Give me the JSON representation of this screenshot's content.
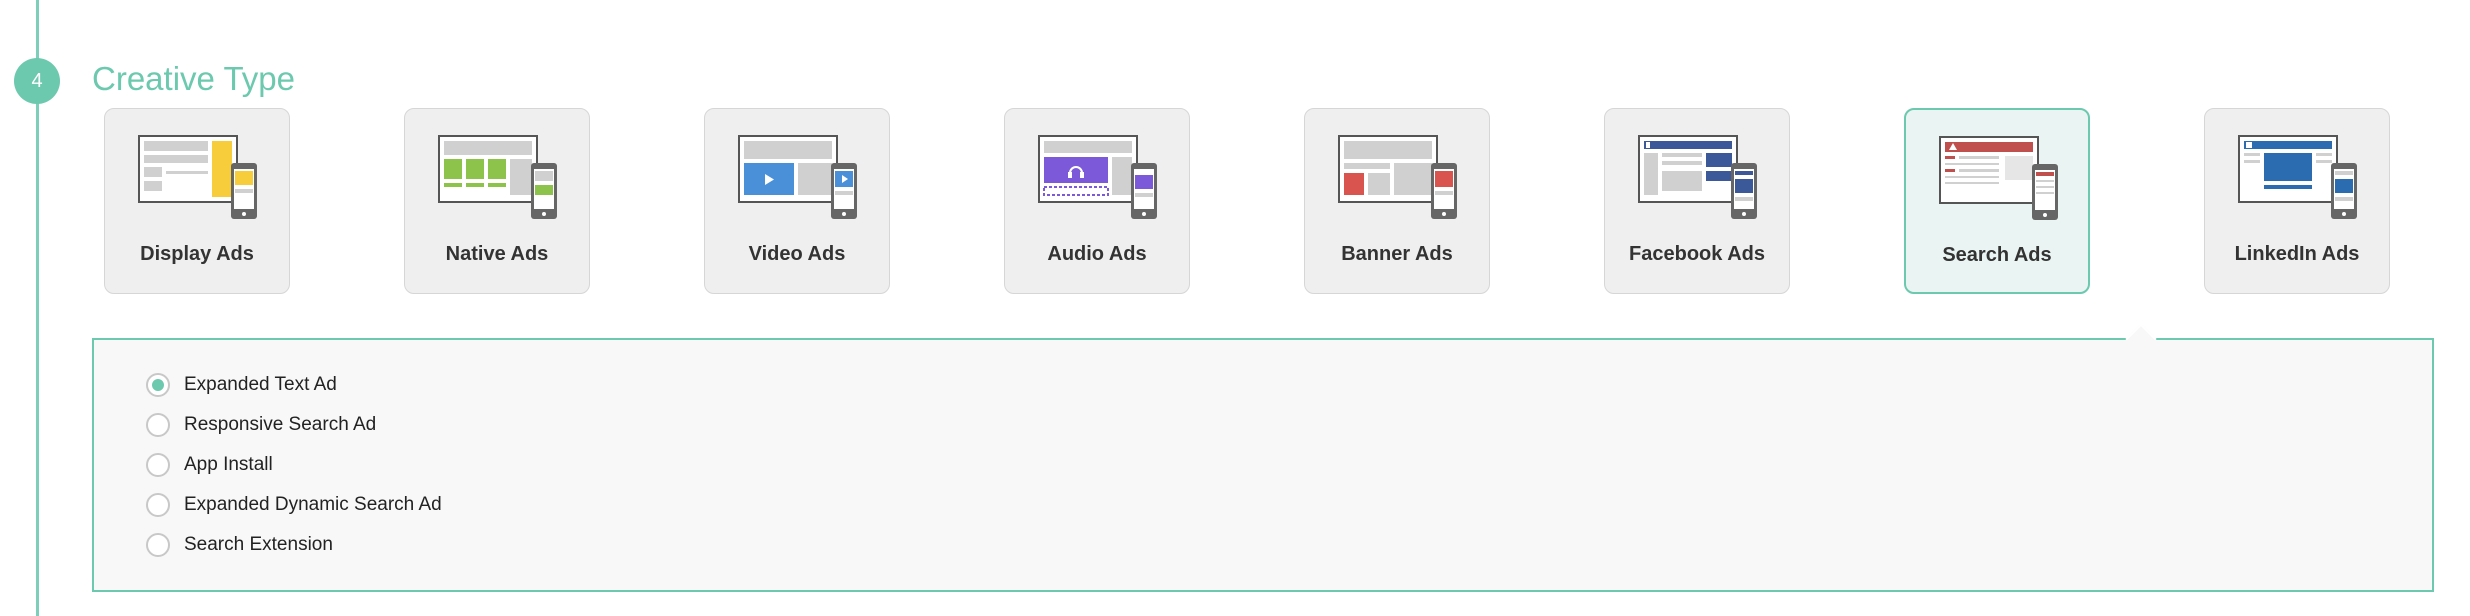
{
  "step": {
    "number": "4",
    "title": "Creative Type"
  },
  "creative_types": [
    {
      "id": "display",
      "label": "Display Ads",
      "icon": "display-ads-icon",
      "selected": false
    },
    {
      "id": "native",
      "label": "Native Ads",
      "icon": "native-ads-icon",
      "selected": false
    },
    {
      "id": "video",
      "label": "Video Ads",
      "icon": "video-ads-icon",
      "selected": false
    },
    {
      "id": "audio",
      "label": "Audio Ads",
      "icon": "audio-ads-icon",
      "selected": false
    },
    {
      "id": "banner",
      "label": "Banner Ads",
      "icon": "banner-ads-icon",
      "selected": false
    },
    {
      "id": "facebook",
      "label": "Facebook Ads",
      "icon": "facebook-ads-icon",
      "selected": false
    },
    {
      "id": "search",
      "label": "Search Ads",
      "icon": "search-ads-icon",
      "selected": true
    },
    {
      "id": "linkedin",
      "label": "LinkedIn Ads",
      "icon": "linkedin-ads-icon",
      "selected": false
    }
  ],
  "search_ad_options": [
    {
      "label": "Expanded Text Ad",
      "checked": true
    },
    {
      "label": "Responsive Search Ad",
      "checked": false
    },
    {
      "label": "App Install",
      "checked": false
    },
    {
      "label": "Expanded Dynamic Search Ad",
      "checked": false
    },
    {
      "label": "Search Extension",
      "checked": false
    }
  ],
  "colors": {
    "accent": "#6cc9ad",
    "display_yellow": "#f7cd3b",
    "native_green": "#8dc34a",
    "video_blue": "#4a90d9",
    "audio_purple": "#7b59d9",
    "banner_red": "#d9534f",
    "facebook_blue": "#3b5998",
    "search_red": "#c0504d",
    "linkedin_blue": "#2b6cb0"
  }
}
